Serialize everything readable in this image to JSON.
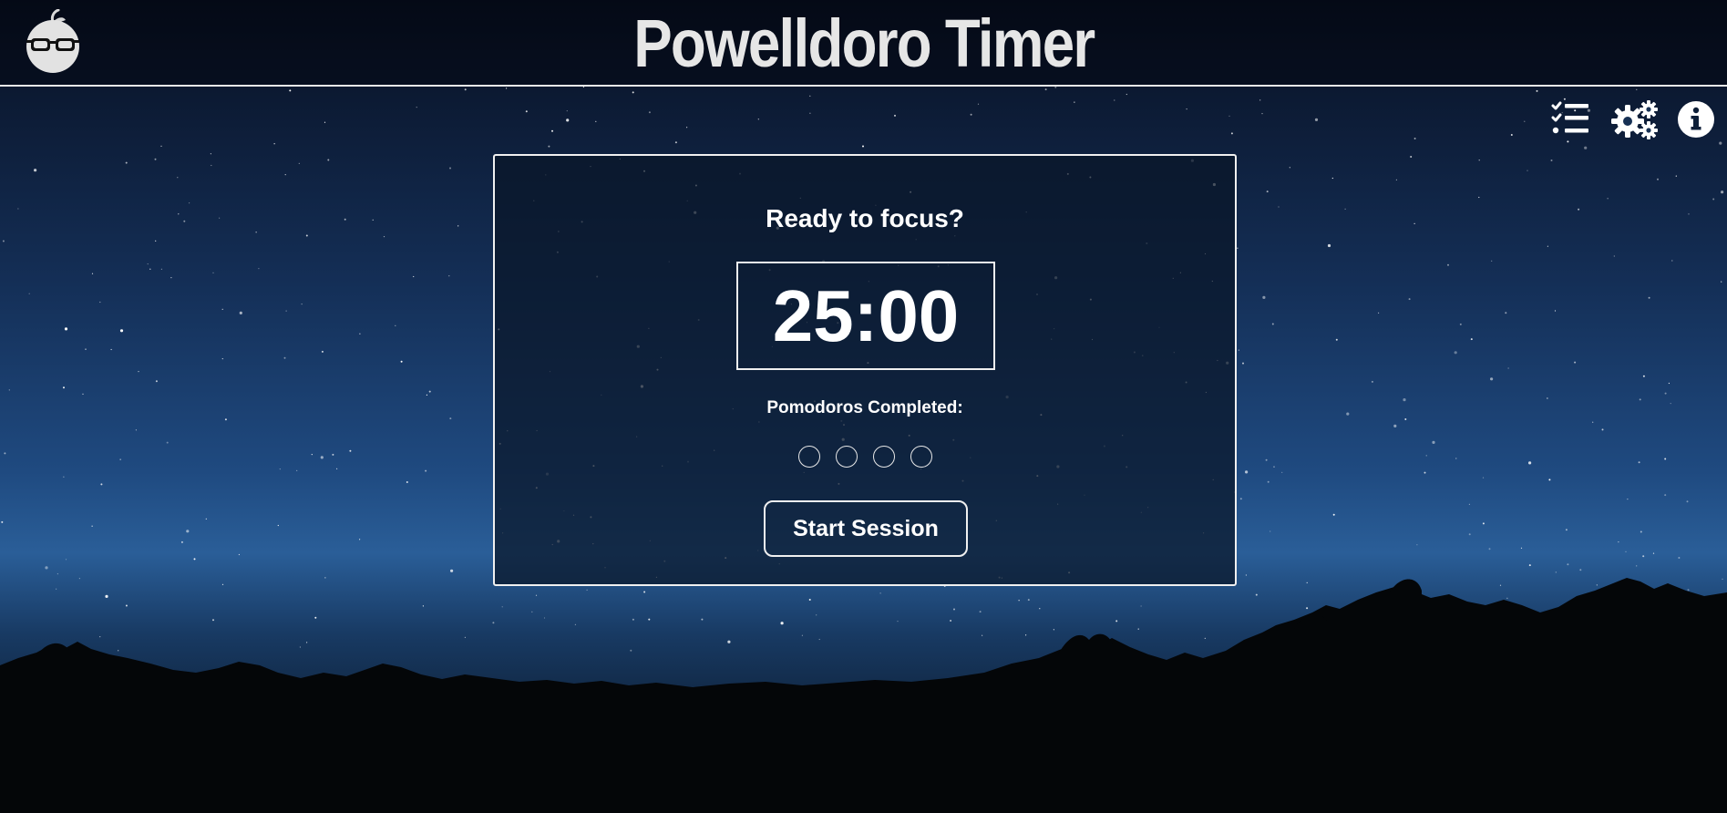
{
  "header": {
    "title": "Powelldoro Timer",
    "logo_icon": "tomato-glasses-logo"
  },
  "toolbar": [
    {
      "icon": "task-list-icon",
      "label": "Tasks"
    },
    {
      "icon": "settings-gears-icon",
      "label": "Settings"
    },
    {
      "icon": "info-icon",
      "label": "Info"
    }
  ],
  "timer": {
    "status": "Ready to focus?",
    "time": "25:00",
    "pomodoros_label": "Pomodoros Completed:",
    "pomodoros_completed": 0,
    "pomodoros_total": 4,
    "start_label": "Start Session"
  },
  "colors": {
    "accent": "#ffffff",
    "sky_top": "#0c1a33",
    "sky_horizon": "#2a5e98",
    "ground": "#050a12"
  }
}
